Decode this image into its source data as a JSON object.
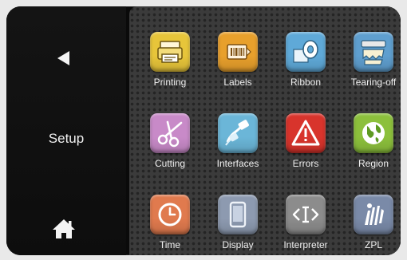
{
  "sidebar": {
    "title": "Setup",
    "back_icon": "back-arrow-icon",
    "home_icon": "home-icon"
  },
  "tiles": [
    {
      "label": "Printing",
      "icon": "printer-icon",
      "color": "#e7c53a"
    },
    {
      "label": "Labels",
      "icon": "label-roll-icon",
      "color": "#e8a02c"
    },
    {
      "label": "Ribbon",
      "icon": "ribbon-roll-icon",
      "color": "#5fa9d8"
    },
    {
      "label": "Tearing-off",
      "icon": "tear-off-icon",
      "color": "#5f9fcf"
    },
    {
      "label": "Cutting",
      "icon": "scissors-icon",
      "color": "#c88ac8"
    },
    {
      "label": "Interfaces",
      "icon": "interfaces-icon",
      "color": "#6bb6d8"
    },
    {
      "label": "Errors",
      "icon": "warning-icon",
      "color": "#d8342c"
    },
    {
      "label": "Region",
      "icon": "globe-icon",
      "color": "#8cc03c"
    },
    {
      "label": "Time",
      "icon": "clock-icon",
      "color": "#e07a4e"
    },
    {
      "label": "Display",
      "icon": "display-icon",
      "color": "#8d9ab0"
    },
    {
      "label": "Interpreter",
      "icon": "interpreter-icon",
      "color": "#8c8c8c"
    },
    {
      "label": "ZPL",
      "icon": "zpl-zebra-icon",
      "color": "#7a8aa8"
    }
  ]
}
